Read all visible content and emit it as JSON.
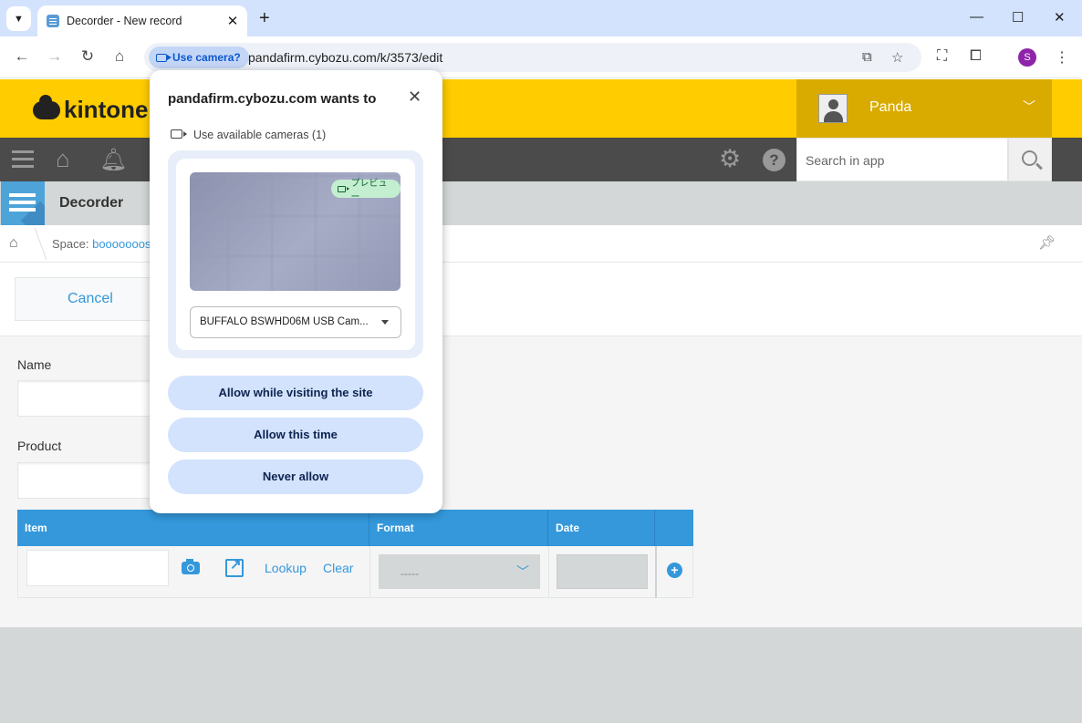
{
  "browser": {
    "tab_title": "Decorder - New record",
    "tab_close": "✕",
    "new_tab": "+",
    "minimize": "—",
    "maximize": "☐",
    "close": "✕",
    "camera_chip": "Use camera?",
    "url": "pandafirm.cybozu.com/k/3573/edit",
    "profile_initial": "S"
  },
  "header": {
    "logo_text": "kintone",
    "user_name": "Panda",
    "search_placeholder": "Search in app"
  },
  "app": {
    "name": "Decorder",
    "breadcrumb_space_label": "Space: ",
    "breadcrumb_space_value": "booooooos"
  },
  "actions": {
    "cancel": "Cancel"
  },
  "form": {
    "name_label": "Name",
    "product_label": "Product",
    "table_headers": [
      "Item",
      "Format",
      "Date"
    ],
    "lookup": "Lookup",
    "clear": "Clear",
    "format_value": "-----",
    "add": "+"
  },
  "popup": {
    "title": "pandafirm.cybozu.com wants to",
    "close": "✕",
    "camera_label": "Use available cameras (1)",
    "preview_badge": "プレビュー",
    "device": "BUFFALO BSWHD06M USB Cam...",
    "allow_visit": "Allow while visiting the site",
    "allow_once": "Allow this time",
    "never": "Never allow"
  }
}
